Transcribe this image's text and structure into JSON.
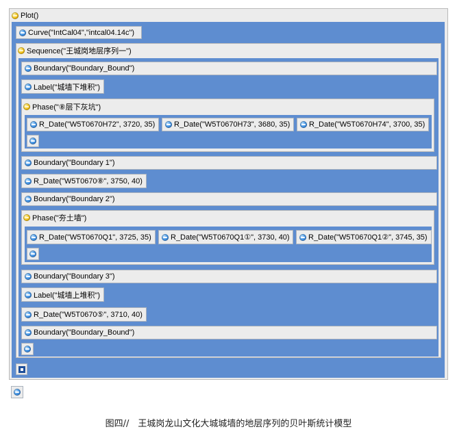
{
  "plot": {
    "label": "Plot()"
  },
  "curve": {
    "label": "Curve(\"IntCal04\",\"intcal04.14c\")"
  },
  "sequence": {
    "label": "Sequence(\"王城岗地层序列一\")",
    "items": {
      "boundary_start": "Boundary(\"Boundary_Bound\")",
      "label_lower": "Label(\"城墙下堆积\")",
      "phase1": {
        "label": "Phase(\"⑧层下灰坑\")",
        "dates": [
          "R_Date(\"W5T0670H72\", 3720, 35)",
          "R_Date(\"W5T0670H73\", 3680, 35)",
          "R_Date(\"W5T0670H74\", 3700, 35)"
        ]
      },
      "boundary_1": "Boundary(\"Boundary 1\")",
      "date_8": "R_Date(\"W5T0670⑧\", 3750, 40)",
      "boundary_2": "Boundary(\"Boundary 2\")",
      "phase2": {
        "label": "Phase(\"夯土墙\")",
        "dates": [
          "R_Date(\"W5T0670Q1\", 3725, 35)",
          "R_Date(\"W5T0670Q1①\", 3730, 40)",
          "R_Date(\"W5T0670Q1②\", 3745, 35)"
        ]
      },
      "boundary_3": "Boundary(\"Boundary 3\")",
      "label_upper": "Label(\"城墙上堆积\")",
      "date_5": "R_Date(\"W5T0670⑤\", 3710, 40)",
      "boundary_end": "Boundary(\"Boundary_Bound\")"
    }
  },
  "caption": "图四//　王城岗龙山文化大城城墙的地层序列的贝叶斯统计模型",
  "colors": {
    "frame_blue": "#5e8dd0",
    "item_bg": "#ececec",
    "sequence_icon": "#f1c21b",
    "item_icon": "#4a9ae8"
  }
}
